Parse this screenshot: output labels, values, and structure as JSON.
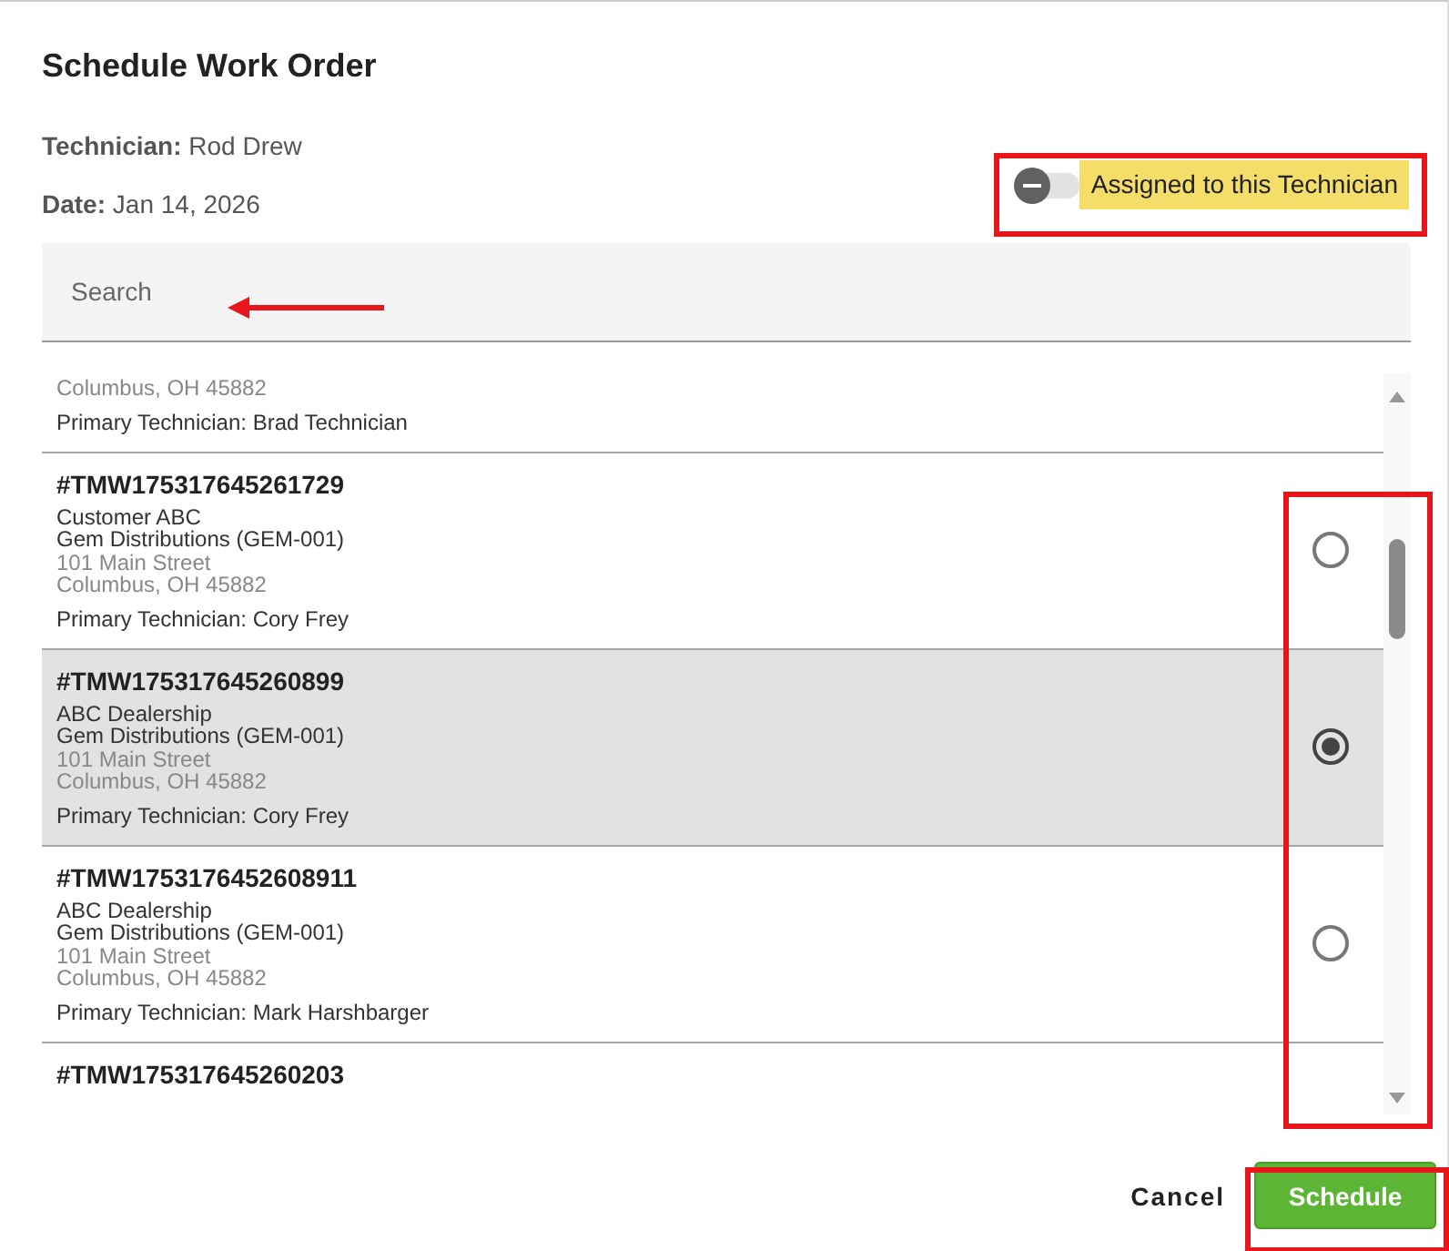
{
  "dialog": {
    "title": "Schedule Work Order"
  },
  "info": [
    {
      "label": "Technician:",
      "value": "Rod Drew"
    },
    {
      "label": "Date:",
      "value": "Jan 14, 2026"
    }
  ],
  "filter_toggle": {
    "label": "Assigned to this Technician",
    "on": false
  },
  "search": {
    "placeholder": "Search"
  },
  "work_orders": [
    {
      "kind": "partial",
      "city": "Columbus, OH 45882",
      "technician": "Primary Technician: Brad Technician"
    },
    {
      "kind": "full",
      "number": "#TMW175317645261729",
      "customer": "Customer ABC",
      "company": "Gem Distributions (GEM-001)",
      "street": "101 Main Street",
      "city": "Columbus, OH 45882",
      "technician": "Primary Technician: Cory Frey",
      "selected": false
    },
    {
      "kind": "full",
      "number": "#TMW175317645260899",
      "customer": "ABC Dealership",
      "company": "Gem Distributions (GEM-001)",
      "street": "101 Main Street",
      "city": "Columbus, OH 45882",
      "technician": "Primary Technician: Cory Frey",
      "selected": true
    },
    {
      "kind": "full",
      "number": "#TMW1753176452608911",
      "customer": "ABC Dealership",
      "company": "Gem Distributions (GEM-001)",
      "street": "101 Main Street",
      "city": "Columbus, OH 45882",
      "technician": "Primary Technician: Mark Harshbarger",
      "selected": false
    },
    {
      "kind": "cut",
      "number": "#TMW175317645260203"
    }
  ],
  "buttons": [
    {
      "kind": "text",
      "label": "Cancel"
    },
    {
      "kind": "primary",
      "label": "Schedule"
    }
  ]
}
